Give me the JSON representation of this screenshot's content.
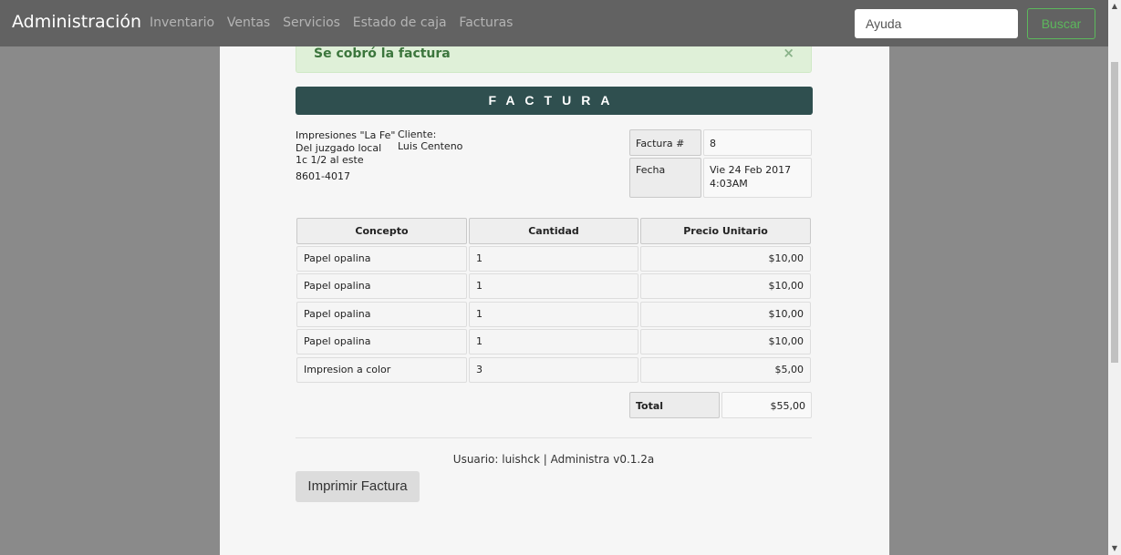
{
  "navbar": {
    "brand": "Administración",
    "links": [
      "Inventario",
      "Ventas",
      "Servicios",
      "Estado de caja",
      "Facturas"
    ],
    "search_placeholder": "Ayuda",
    "search_button": "Buscar"
  },
  "alert": {
    "message": "Se cobró la factura",
    "close": "×"
  },
  "invoice": {
    "title": "FACTURA",
    "company": [
      "Impresiones \"La Fe\"",
      "Del juzgado local",
      "1c 1/2 al este",
      "8601-4017"
    ],
    "client_label": "Cliente:",
    "client_name": "Luis Centeno",
    "number_label": "Factura #",
    "number": "8",
    "date_label": "Fecha",
    "date": "Vie 24 Feb 2017",
    "time": "4:03AM",
    "columns": [
      "Concepto",
      "Cantidad",
      "Precio Unitario"
    ],
    "rows": [
      {
        "concepto": "Papel opalina",
        "cantidad": "1",
        "precio": "$10,00"
      },
      {
        "concepto": "Papel opalina",
        "cantidad": "1",
        "precio": "$10,00"
      },
      {
        "concepto": "Papel opalina",
        "cantidad": "1",
        "precio": "$10,00"
      },
      {
        "concepto": "Papel opalina",
        "cantidad": "1",
        "precio": "$10,00"
      },
      {
        "concepto": "Impresion a color",
        "cantidad": "3",
        "precio": "$5,00"
      }
    ],
    "total_label": "Total",
    "total": "$55,00"
  },
  "footer": {
    "text": "Usuario: luishck | Administra v0.1.2a",
    "print_button": "Imprimir Factura"
  },
  "colors": {
    "header_bg": "#2f4f4f",
    "success_text": "#3c763d",
    "success_bg": "#dff0d8",
    "buscar_green": "#5cb85c"
  }
}
